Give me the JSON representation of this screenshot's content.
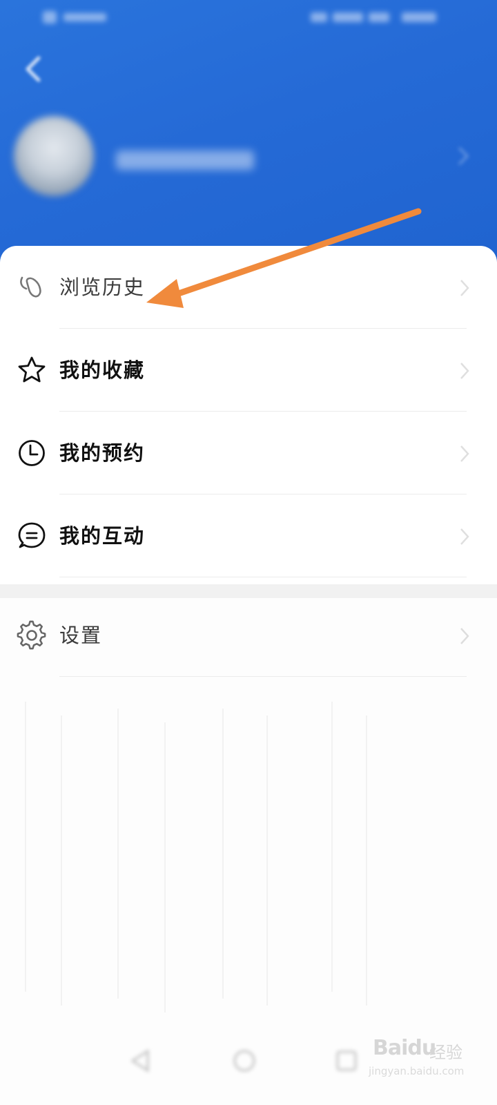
{
  "menu": {
    "items": [
      {
        "label": "浏览历史",
        "icon": "footprint-icon"
      },
      {
        "label": "我的收藏",
        "icon": "star-icon"
      },
      {
        "label": "我的预约",
        "icon": "clock-icon"
      },
      {
        "label": "我的互动",
        "icon": "chat-icon"
      }
    ],
    "settings": {
      "label": "设置",
      "icon": "gear-icon"
    }
  },
  "watermark": {
    "brand": "Baidu",
    "product": "经验",
    "url": "jingyan.baidu.com"
  },
  "colors": {
    "header_blue": "#256ad6",
    "annotation_orange": "#f08a3c",
    "card_bg": "#ffffff"
  }
}
